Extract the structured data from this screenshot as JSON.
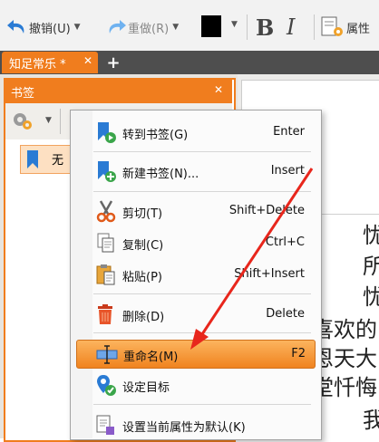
{
  "toolbar": {
    "undo_label": "撤销(U)",
    "redo_label": "重做(R)",
    "bold_label": "B",
    "italic_label": "I",
    "props_label": "属性"
  },
  "tabs": [
    {
      "label": "知足常乐 *"
    }
  ],
  "bookmarks": {
    "title": "书签",
    "item_label": "无"
  },
  "document": {
    "lines": [
      "忧",
      "所",
      "忧",
      "喜欢的",
      "恩天大",
      "堂忏悔",
      "我"
    ]
  },
  "context_menu": {
    "items": [
      {
        "label": "转到书签(G)",
        "shortcut": "Enter",
        "icon": "goto-bookmark-icon"
      },
      {
        "label": "新建书签(N)...",
        "shortcut": "Insert",
        "icon": "new-bookmark-icon"
      },
      {
        "label": "剪切(T)",
        "shortcut": "Shift+Delete",
        "icon": "scissors-icon"
      },
      {
        "label": "复制(C)",
        "shortcut": "Ctrl+C",
        "icon": "copy-icon"
      },
      {
        "label": "粘贴(P)",
        "shortcut": "Shift+Insert",
        "icon": "paste-icon"
      },
      {
        "label": "删除(D)",
        "shortcut": "Delete",
        "icon": "trash-icon"
      },
      {
        "label": "重命名(M)",
        "shortcut": "F2",
        "icon": "rename-icon",
        "highlighted": true
      },
      {
        "label": "设定目标",
        "shortcut": "",
        "icon": "set-target-icon"
      },
      {
        "label": "设置当前属性为默认(K)",
        "shortcut": "",
        "icon": "set-default-icon"
      }
    ]
  },
  "colors": {
    "accent": "#f07d1e",
    "highlight_top": "#fcb45e",
    "highlight_bottom": "#f0831f",
    "tabstrip": "#4e4e4e",
    "arrow": "#e8261c"
  }
}
